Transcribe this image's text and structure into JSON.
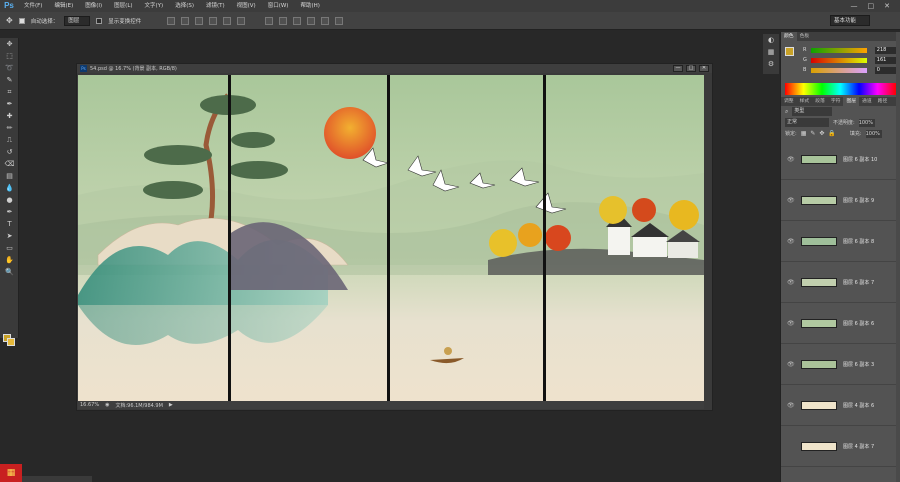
{
  "app": {
    "logo": "Ps"
  },
  "menu": [
    "文件(F)",
    "编辑(E)",
    "图像(I)",
    "图层(L)",
    "文字(Y)",
    "选择(S)",
    "滤镜(T)",
    "视图(V)",
    "窗口(W)",
    "帮助(H)"
  ],
  "window_controls": [
    "—",
    "□",
    "✕"
  ],
  "options": {
    "auto_select_label": "自动选择：",
    "auto_select_value": "图层",
    "show_transform_label": "显示变换控件",
    "workspace": "基本功能"
  },
  "tools": [
    "move-icon",
    "marquee-icon",
    "lasso-icon",
    "quick-select-icon",
    "crop-icon",
    "eyedropper-icon",
    "healing-icon",
    "brush-icon",
    "stamp-icon",
    "history-brush-icon",
    "eraser-icon",
    "gradient-icon",
    "blur-icon",
    "dodge-icon",
    "pen-icon",
    "type-icon",
    "path-select-icon",
    "shape-icon",
    "hand-icon",
    "zoom-icon"
  ],
  "tool_glyphs": [
    "✥",
    "⬚",
    "➰",
    "✎",
    "⌗",
    "✒",
    "✚",
    "✏",
    "⎍",
    "↺",
    "⌫",
    "▤",
    "💧",
    "●",
    "✒",
    "T",
    "➤",
    "▭",
    "✋",
    "🔍"
  ],
  "colors": {
    "foreground": "#c9a227",
    "background": "#e4b83a"
  },
  "color_panel": {
    "tabs": [
      "颜色",
      "色板"
    ],
    "channels": [
      {
        "label": "R",
        "value": "218"
      },
      {
        "label": "G",
        "value": "161"
      },
      {
        "label": "B",
        "value": "0"
      }
    ]
  },
  "layers_panel": {
    "tabs": [
      "调整",
      "样式",
      "段落",
      "字符",
      "图层",
      "通道",
      "路径"
    ],
    "filter": "类型",
    "blend_mode": "正常",
    "opacity_label": "不透明度:",
    "opacity_value": "100%",
    "lock_label": "锁定:",
    "fill_label": "填充:",
    "fill_value": "100%",
    "layers": [
      {
        "name": "图层 6 副本 10",
        "visible": true
      },
      {
        "name": "图层 6 副本 9",
        "visible": true
      },
      {
        "name": "图层 6 副本 8",
        "visible": true
      },
      {
        "name": "图层 6 副本 7",
        "visible": true
      },
      {
        "name": "图层 6 副本 6",
        "visible": true
      },
      {
        "name": "图层 6 副本 3",
        "visible": true
      },
      {
        "name": "图层 4 副本 6",
        "visible": true
      },
      {
        "name": "图层 4 副本 7",
        "visible": false
      }
    ]
  },
  "document": {
    "title": "54.psd @ 16.7% (背景 副本, RGB/8)",
    "zoom": "16.67%",
    "doc_info": "文档:96.1M/984.9M"
  }
}
